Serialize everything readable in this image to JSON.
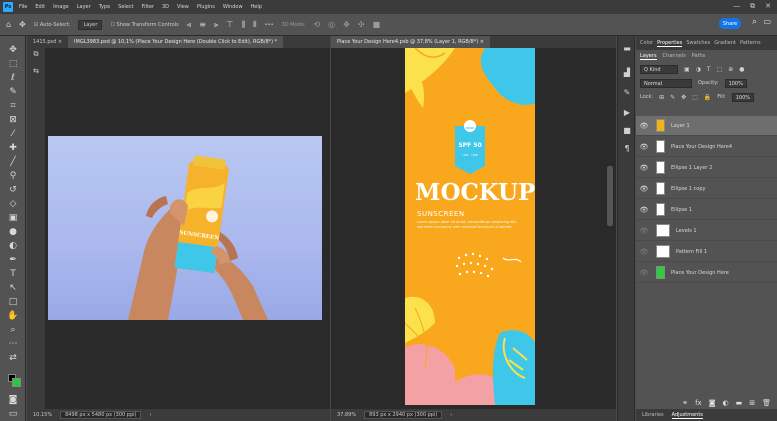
{
  "app": {
    "logo": "Ps",
    "menu": [
      "File",
      "Edit",
      "Image",
      "Layer",
      "Type",
      "Select",
      "Filter",
      "3D",
      "View",
      "Plugins",
      "Window",
      "Help"
    ],
    "window_controls": [
      "—",
      "⧉",
      "✕"
    ]
  },
  "options_bar": {
    "auto_select_label": "Auto-Select:",
    "auto_select_value": "Layer",
    "show_transform_label": "Show Transform Controls",
    "more": "•••",
    "mode_3d": "3D Mode:",
    "share_label": "Share"
  },
  "left_doc": {
    "tabs": [
      "1415.psd ×",
      "IMGL3983.psd @ 10,1% (Place Your Design Here (Double Click to Edit), RGB/8*) *"
    ],
    "zoom": "10,15%",
    "doc_info": "8498 px x 5480 px (300 ppi)"
  },
  "right_doc": {
    "tab": "Place Your Design Here4.psb @ 37,8% (Layer 1, RGB/8*) ×",
    "zoom": "37,89%",
    "doc_info": "893 px x 2940 px (300 ppi)"
  },
  "mockup": {
    "spf": "SPF 50",
    "spf_small": "UVA · UVB",
    "title": "MOCKUP",
    "subtitle": "SUNSCREEN",
    "body": "Lorem ipsum dolor sit amet, consectetuer adipiscing elit, sed diam nonummy nibh euismod tincidunt ut laoreet"
  },
  "tube": {
    "label": "SUNSCREEN"
  },
  "panels": {
    "top_tabs": [
      "Color",
      "Properties",
      "Swatches",
      "Gradient",
      "Patterns"
    ],
    "active_top_tab": "Properties",
    "sub_tabs": [
      "Layers",
      "Channels",
      "Paths"
    ],
    "kind_filter": "Q Kind",
    "blend_mode": "Normal",
    "opacity_label": "Opacity:",
    "opacity_value": "100%",
    "lock_label": "Lock:",
    "fill_label": "Fill:",
    "fill_value": "100%",
    "layers": [
      {
        "name": "Layer 1",
        "selected": true,
        "thumb_color": "#f4b21a"
      },
      {
        "name": "Place Your Design Here4",
        "selected": false,
        "thumb_color": "#ffffff"
      },
      {
        "name": "Ellipse 1 Layer 2",
        "selected": false,
        "thumb_color": "#ffffff"
      },
      {
        "name": "Ellipse 1 copy",
        "selected": false,
        "thumb_color": "#ffffff"
      },
      {
        "name": "Ellipse 1",
        "selected": false,
        "thumb_color": "#ffffff"
      },
      {
        "name": "Levels 1",
        "selected": false,
        "thumb_color": "#ffffff"
      },
      {
        "name": "Pattern Fill 1",
        "selected": false,
        "thumb_color": "#ffffff"
      },
      {
        "name": "Place Your Design Here",
        "selected": false,
        "thumb_color": "#2ecc40"
      }
    ],
    "bottom_tabs": [
      "Libraries",
      "Adjustments"
    ]
  },
  "colors": {
    "accent_blue": "#1473e6",
    "mockup_orange": "#f9a71c",
    "mockup_cyan": "#3ec7e8",
    "mockup_pink": "#f4a1a6",
    "leaf_yellow": "#fbe14b"
  }
}
